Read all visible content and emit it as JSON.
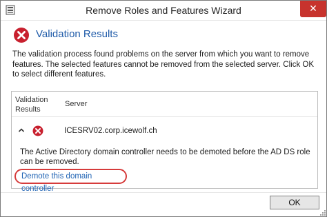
{
  "window": {
    "title": "Remove Roles and Features Wizard",
    "close_glyph": "✕"
  },
  "header": {
    "icon": "error-icon",
    "title": "Validation Results"
  },
  "message": "The validation process found problems on the server from which you want to remove features. The selected features cannot be removed from the selected server.  Click OK to select different features.",
  "results": {
    "columns": [
      "Validation Results",
      "Server"
    ],
    "rows": [
      {
        "expand_icon": "chevron-up-icon",
        "status_icon": "error-icon",
        "server": "ICESRV02.corp.icewolf.ch",
        "detail": "The Active Directory domain controller needs to be demoted before the AD DS role can be removed.",
        "link": "Demote this domain controller"
      }
    ]
  },
  "footer": {
    "ok_label": "OK"
  },
  "colors": {
    "accent": "#1e5aa8",
    "error": "#c8202e",
    "link": "#1f63b4",
    "highlight_circle": "#d63b3b",
    "close_button": "#c7332d"
  }
}
